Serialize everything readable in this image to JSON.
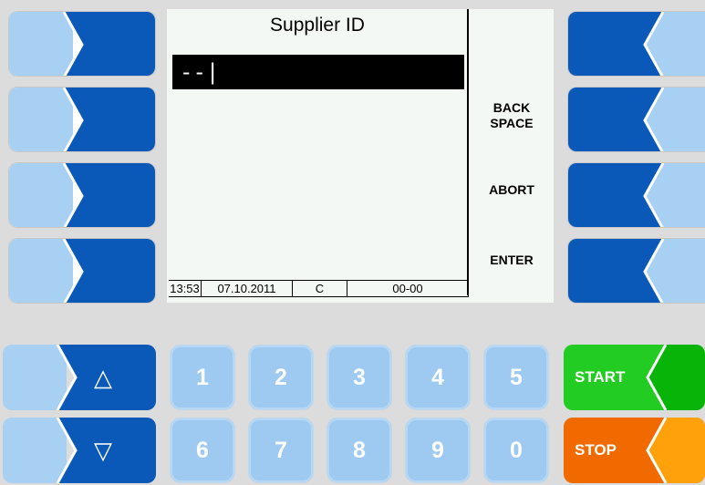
{
  "display": {
    "title": "Supplier ID",
    "input_value": "--|",
    "softkeys": {
      "backspace_line1": "BACK",
      "backspace_line2": "SPACE",
      "abort": "ABORT",
      "enter": "ENTER"
    },
    "status": {
      "time": "13:53",
      "date": "07.10.2011",
      "mode": "C",
      "code": "00-00"
    }
  },
  "keypad": {
    "row1": [
      "1",
      "2",
      "3",
      "4",
      "5"
    ],
    "row2": [
      "6",
      "7",
      "8",
      "9",
      "0"
    ]
  },
  "controls": {
    "start": "START",
    "stop": "STOP"
  },
  "arrows": {
    "up": "△",
    "down": "▽"
  },
  "colors": {
    "key_light": "#a8d0f2",
    "key_dark": "#0a59b8",
    "start_green": "#22cc22",
    "stop_orange": "#f06a00"
  }
}
